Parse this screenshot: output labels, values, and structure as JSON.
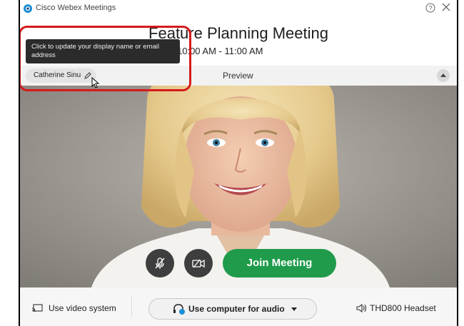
{
  "window": {
    "app_title": "Cisco Webex Meetings",
    "app_icon": "webex-logo-icon",
    "help_icon": "help-icon",
    "close_icon": "close-icon"
  },
  "meeting": {
    "title": "Feature Planning Meeting",
    "time": "10:00 AM - 11:00 AM"
  },
  "preview": {
    "user_name": "Catherine Sinu",
    "edit_icon": "pencil-icon",
    "label": "Preview",
    "collapse_icon": "collapse-up-icon",
    "tooltip": "Click to update your display name or email address"
  },
  "controls": {
    "mute_icon": "microphone-muted-icon",
    "camera_icon": "video-camera-off-icon",
    "join_label": "Join Meeting",
    "join_color": "#1f9b4b"
  },
  "bottom": {
    "video_system_label": "Use video system",
    "video_system_icon": "screen-cast-icon",
    "audio_label": "Use computer for audio",
    "audio_icon": "headset-icon",
    "audio_caret_icon": "chevron-down-icon",
    "speaker_label": "THD800 Headset",
    "speaker_icon": "speaker-icon"
  },
  "annotation": {
    "highlight_color": "#d51a1a"
  }
}
